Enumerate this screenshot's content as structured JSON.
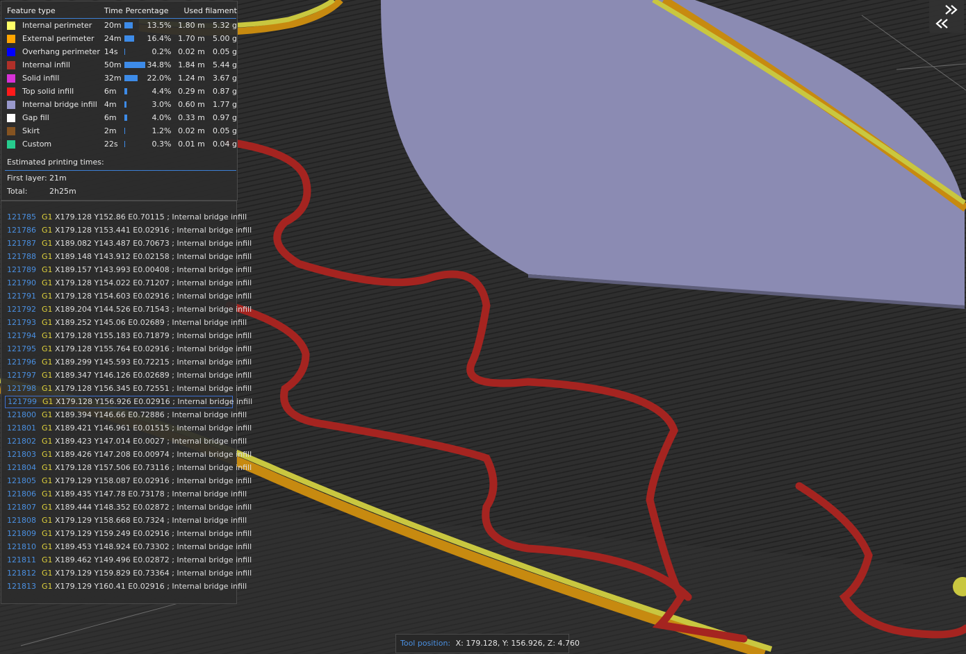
{
  "legend": {
    "headers": {
      "feature": "Feature type",
      "time": "Time",
      "percentage": "Percentage",
      "filament": "Used filament"
    },
    "rows": [
      {
        "name": "Internal perimeter",
        "color": "#ffff68",
        "time": "20m",
        "bar": 0.39,
        "pct": "13.5%",
        "len": "1.80 m",
        "weight": "5.32 g"
      },
      {
        "name": "External perimeter",
        "color": "#ffa500",
        "time": "24m",
        "bar": 0.47,
        "pct": "16.4%",
        "len": "1.70 m",
        "weight": "5.00 g"
      },
      {
        "name": "Overhang perimeter",
        "color": "#0000ff",
        "time": "14s",
        "bar": 0.01,
        "pct": "0.2%",
        "len": "0.02 m",
        "weight": "0.05 g"
      },
      {
        "name": "Internal infill",
        "color": "#b03029",
        "time": "50m",
        "bar": 1.0,
        "pct": "34.8%",
        "len": "1.84 m",
        "weight": "5.44 g"
      },
      {
        "name": "Solid infill",
        "color": "#d732d7",
        "time": "32m",
        "bar": 0.63,
        "pct": "22.0%",
        "len": "1.24 m",
        "weight": "3.67 g"
      },
      {
        "name": "Top solid infill",
        "color": "#ff1a1a",
        "time": "6m",
        "bar": 0.13,
        "pct": "4.4%",
        "len": "0.29 m",
        "weight": "0.87 g"
      },
      {
        "name": "Internal bridge infill",
        "color": "#9999cc",
        "time": "4m",
        "bar": 0.09,
        "pct": "3.0%",
        "len": "0.60 m",
        "weight": "1.77 g"
      },
      {
        "name": "Gap fill",
        "color": "#ffffff",
        "time": "6m",
        "bar": 0.12,
        "pct": "4.0%",
        "len": "0.33 m",
        "weight": "0.97 g"
      },
      {
        "name": "Skirt",
        "color": "#845321",
        "time": "2m",
        "bar": 0.03,
        "pct": "1.2%",
        "len": "0.02 m",
        "weight": "0.05 g"
      },
      {
        "name": "Custom",
        "color": "#27cc8e",
        "time": "22s",
        "bar": 0.01,
        "pct": "0.3%",
        "len": "0.01 m",
        "weight": "0.04 g"
      }
    ],
    "estimated_title": "Estimated printing times:",
    "first_layer_label": "First layer:",
    "first_layer_value": "21m",
    "total_label": "Total:",
    "total_value": "2h25m"
  },
  "gcode": {
    "selected": "121799",
    "lines": [
      {
        "num": "121785",
        "cmd": "G1",
        "text": "X179.128 Y152.86 E0.70115 ; Internal bridge infill"
      },
      {
        "num": "121786",
        "cmd": "G1",
        "text": "X179.128 Y153.441 E0.02916 ; Internal bridge infill"
      },
      {
        "num": "121787",
        "cmd": "G1",
        "text": "X189.082 Y143.487 E0.70673 ; Internal bridge infill"
      },
      {
        "num": "121788",
        "cmd": "G1",
        "text": "X189.148 Y143.912 E0.02158 ; Internal bridge infill"
      },
      {
        "num": "121789",
        "cmd": "G1",
        "text": "X189.157 Y143.993 E0.00408 ; Internal bridge infill"
      },
      {
        "num": "121790",
        "cmd": "G1",
        "text": "X179.128 Y154.022 E0.71207 ; Internal bridge infill"
      },
      {
        "num": "121791",
        "cmd": "G1",
        "text": "X179.128 Y154.603 E0.02916 ; Internal bridge infill"
      },
      {
        "num": "121792",
        "cmd": "G1",
        "text": "X189.204 Y144.526 E0.71543 ; Internal bridge infill"
      },
      {
        "num": "121793",
        "cmd": "G1",
        "text": "X189.252 Y145.06 E0.02689 ; Internal bridge infill"
      },
      {
        "num": "121794",
        "cmd": "G1",
        "text": "X179.128 Y155.183 E0.71879 ; Internal bridge infill"
      },
      {
        "num": "121795",
        "cmd": "G1",
        "text": "X179.128 Y155.764 E0.02916 ; Internal bridge infill"
      },
      {
        "num": "121796",
        "cmd": "G1",
        "text": "X189.299 Y145.593 E0.72215 ; Internal bridge infill"
      },
      {
        "num": "121797",
        "cmd": "G1",
        "text": "X189.347 Y146.126 E0.02689 ; Internal bridge infill"
      },
      {
        "num": "121798",
        "cmd": "G1",
        "text": "X179.128 Y156.345 E0.72551 ; Internal bridge infill"
      },
      {
        "num": "121799",
        "cmd": "G1",
        "text": "X179.128 Y156.926 E0.02916 ; Internal bridge infill"
      },
      {
        "num": "121800",
        "cmd": "G1",
        "text": "X189.394 Y146.66 E0.72886 ; Internal bridge infill"
      },
      {
        "num": "121801",
        "cmd": "G1",
        "text": "X189.421 Y146.961 E0.01515 ; Internal bridge infill"
      },
      {
        "num": "121802",
        "cmd": "G1",
        "text": "X189.423 Y147.014 E0.0027 ; Internal bridge infill"
      },
      {
        "num": "121803",
        "cmd": "G1",
        "text": "X189.426 Y147.208 E0.00974 ; Internal bridge infill"
      },
      {
        "num": "121804",
        "cmd": "G1",
        "text": "X179.128 Y157.506 E0.73116 ; Internal bridge infill"
      },
      {
        "num": "121805",
        "cmd": "G1",
        "text": "X179.129 Y158.087 E0.02916 ; Internal bridge infill"
      },
      {
        "num": "121806",
        "cmd": "G1",
        "text": "X189.435 Y147.78 E0.73178 ; Internal bridge infill"
      },
      {
        "num": "121807",
        "cmd": "G1",
        "text": "X189.444 Y148.352 E0.02872 ; Internal bridge infill"
      },
      {
        "num": "121808",
        "cmd": "G1",
        "text": "X179.129 Y158.668 E0.7324 ; Internal bridge infill"
      },
      {
        "num": "121809",
        "cmd": "G1",
        "text": "X179.129 Y159.249 E0.02916 ; Internal bridge infill"
      },
      {
        "num": "121810",
        "cmd": "G1",
        "text": "X189.453 Y148.924 E0.73302 ; Internal bridge infill"
      },
      {
        "num": "121811",
        "cmd": "G1",
        "text": "X189.462 Y149.496 E0.02872 ; Internal bridge infill"
      },
      {
        "num": "121812",
        "cmd": "G1",
        "text": "X179.129 Y159.829 E0.73364 ; Internal bridge infill"
      },
      {
        "num": "121813",
        "cmd": "G1",
        "text": "X179.129 Y160.41 E0.02916 ; Internal bridge infill"
      }
    ]
  },
  "tool_position": {
    "label": "Tool position:",
    "value": "X: 179.128, Y: 156.926, Z: 4.760"
  },
  "icons": {
    "collapse": "double-chevron-icon"
  },
  "colors": {
    "accent": "#4a8fe0",
    "gcode_cmd": "#e0d23c",
    "background": "#262626"
  }
}
